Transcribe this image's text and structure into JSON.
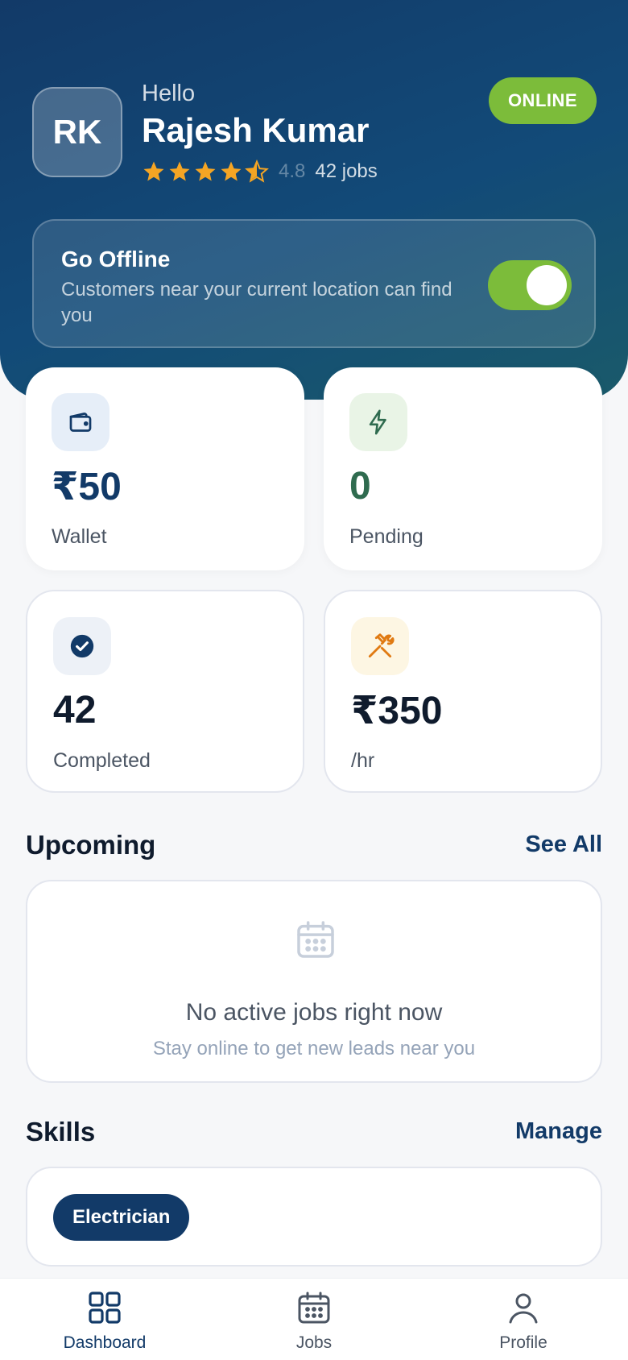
{
  "header": {
    "avatar_initials": "RK",
    "greeting": "Hello",
    "user_name": "Rajesh Kumar",
    "rating": "4.8",
    "rating_stars": 4.5,
    "jobs_count": "42 jobs",
    "status_badge": "ONLINE"
  },
  "availability": {
    "title": "Go Offline",
    "subtitle": "Customers near your current location can find you",
    "toggle_on": true
  },
  "stats": [
    {
      "value": "₹50",
      "label": "Wallet",
      "icon": "wallet-icon"
    },
    {
      "value": "0",
      "label": "Pending",
      "icon": "lightning-icon"
    },
    {
      "value": "42",
      "label": "Completed",
      "icon": "check-circle-icon"
    },
    {
      "value": "₹350",
      "label": "/hr",
      "icon": "tools-icon"
    }
  ],
  "upcoming": {
    "title": "Upcoming",
    "link": "See All",
    "empty_title": "No active jobs right now",
    "empty_subtitle": "Stay online to get new leads near you"
  },
  "skills": {
    "title": "Skills",
    "link": "Manage",
    "items": [
      "Electrician"
    ]
  },
  "nav": {
    "items": [
      {
        "label": "Dashboard",
        "icon": "grid-icon",
        "active": true
      },
      {
        "label": "Jobs",
        "icon": "calendar-icon",
        "active": false
      },
      {
        "label": "Profile",
        "icon": "user-icon",
        "active": false
      }
    ]
  },
  "colors": {
    "primary": "#123a68",
    "accent_green": "#7cbc3a",
    "star": "#f5a524",
    "pending_green": "#2f6b4f",
    "tools_orange": "#e07a12"
  }
}
